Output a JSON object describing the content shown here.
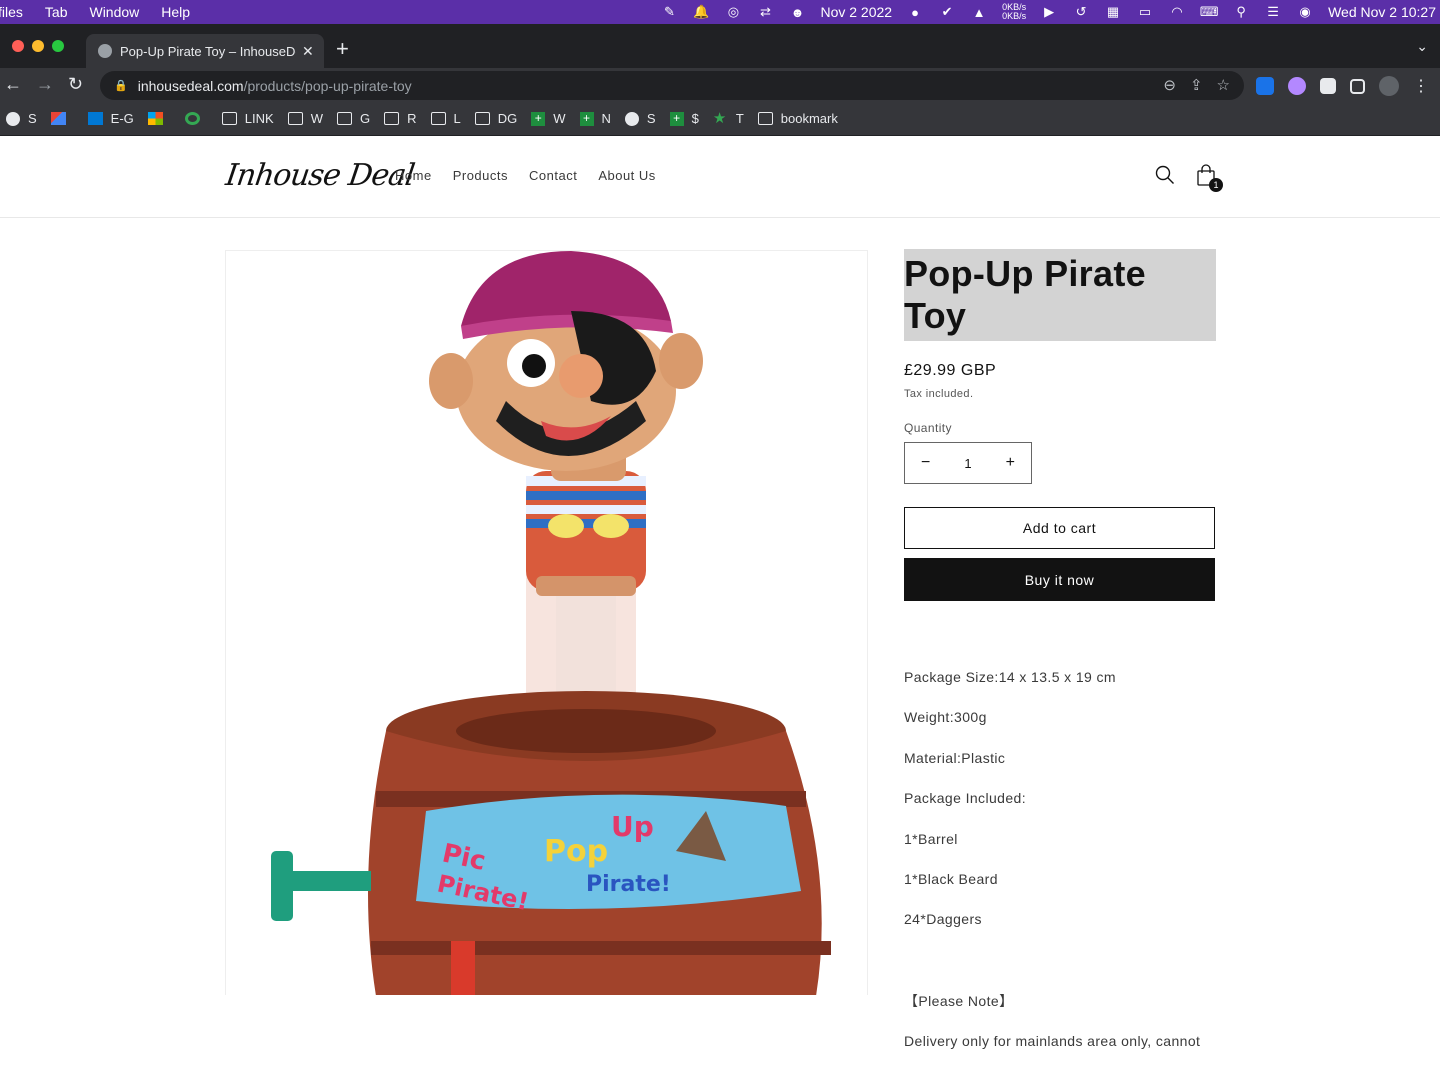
{
  "menubar": {
    "items": [
      "files",
      "Tab",
      "Window",
      "Help"
    ],
    "date": "Nov 2 2022",
    "net_up": "0KB/s",
    "net_down": "0KB/s",
    "clock": "Wed Nov 2  10:27"
  },
  "tab": {
    "title": "Pop-Up Pirate Toy – InhouseDeal",
    "close": "✕"
  },
  "omnibox": {
    "host": "inhousedeal.com",
    "path": "/products/pop-up-pirate-toy"
  },
  "bookmarks": [
    {
      "label": "S",
      "icon": "globe-icon"
    },
    {
      "label": "",
      "icon": "gmail-icon"
    },
    {
      "label": "E-G",
      "icon": "outlook-icon"
    },
    {
      "label": "",
      "icon": "microsoft-icon"
    },
    {
      "label": "",
      "icon": "grammarly-icon"
    },
    {
      "label": "LINK",
      "icon": "folder-icon"
    },
    {
      "label": "W",
      "icon": "folder-icon"
    },
    {
      "label": "G",
      "icon": "folder-icon"
    },
    {
      "label": "R",
      "icon": "folder-icon"
    },
    {
      "label": "L",
      "icon": "folder-icon"
    },
    {
      "label": "DG",
      "icon": "folder-icon"
    },
    {
      "label": "W",
      "icon": "cross-icon"
    },
    {
      "label": "N",
      "icon": "cross-icon"
    },
    {
      "label": "S",
      "icon": "globe-icon"
    },
    {
      "label": "$",
      "icon": "cross-icon"
    },
    {
      "label": "T",
      "icon": "star-icon"
    },
    {
      "label": "bookmark",
      "icon": "folder-icon"
    }
  ],
  "site": {
    "logo": "Inhouse Deal",
    "nav": [
      "Home",
      "Products",
      "Contact",
      "About Us"
    ],
    "cart_count": "1"
  },
  "product": {
    "title": "Pop-Up Pirate Toy",
    "price": "£29.99 GBP",
    "tax_note": "Tax included.",
    "quantity_label": "Quantity",
    "quantity": "1",
    "qty_minus": "−",
    "qty_plus": "+",
    "add_to_cart": "Add to cart",
    "buy_now": "Buy it now",
    "description": [
      "Package Size:14 x 13.5 x 19 cm",
      "Weight:300g",
      "Material:Plastic",
      "Package Included:",
      "1*Barrel",
      "1*Black Beard",
      "24*Daggers"
    ],
    "note_heading": "【Please Note】",
    "note_text": "Delivery only for mainlands area only, cannot"
  },
  "colors": {
    "menubar": "#5b2fa8",
    "chrome_dark": "#202124",
    "chrome_mid": "#35363a",
    "buy_button": "#121212",
    "title_highlight": "#d3d3d3"
  }
}
